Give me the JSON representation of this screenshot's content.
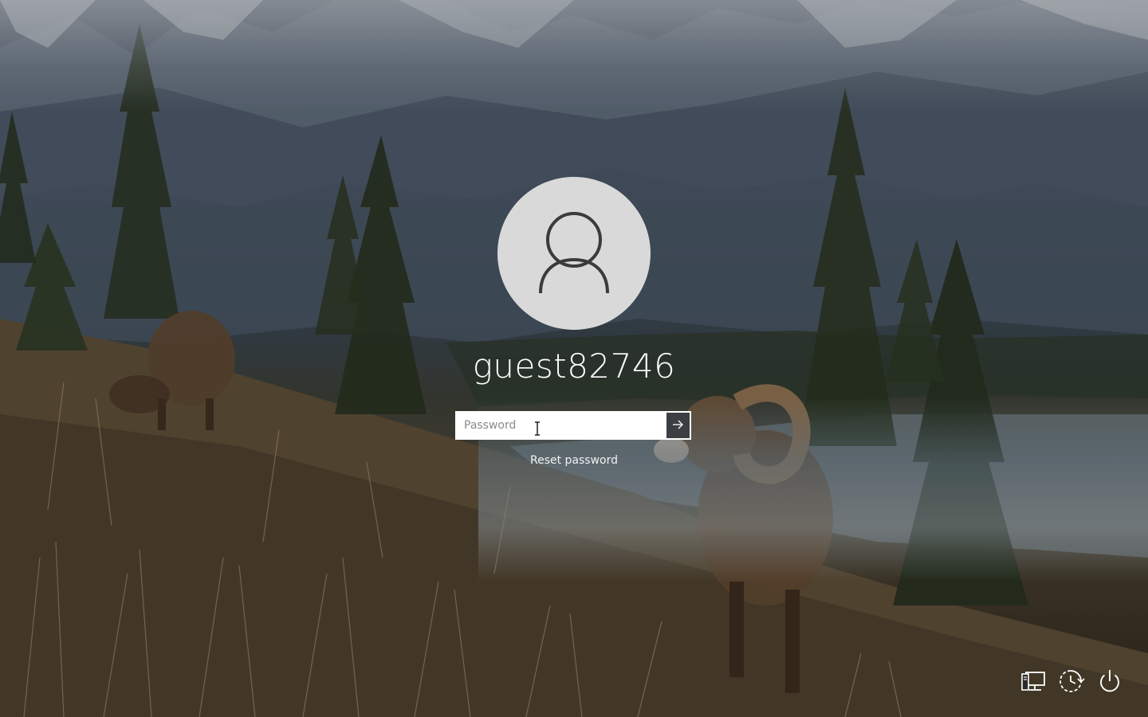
{
  "lock_screen": {
    "username": "guest82746",
    "password_field": {
      "value": "",
      "placeholder": "Password"
    },
    "reset_password_label": "Reset password",
    "avatar_icon": "user-silhouette-icon",
    "submit_icon": "arrow-right-icon"
  },
  "tray": {
    "icons": [
      "network-icon",
      "ease-of-access-icon",
      "power-icon"
    ]
  },
  "colors": {
    "avatar_bg": "#d9d9d9",
    "avatar_fg": "#3b3b3b",
    "submit_bg": "#3b3f43",
    "text": "#ffffff"
  }
}
